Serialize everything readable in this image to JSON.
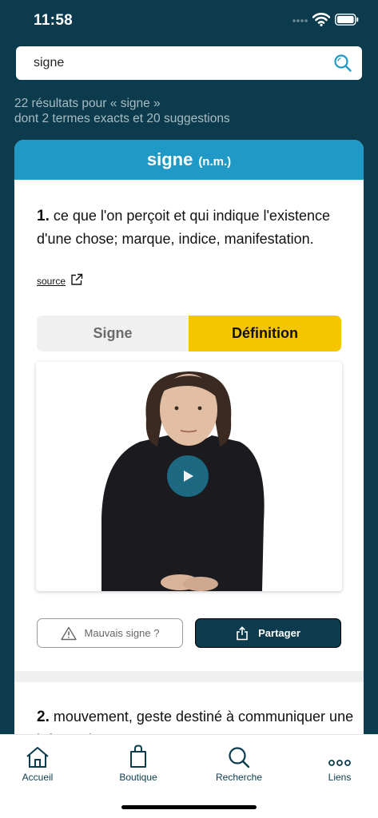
{
  "status_bar": {
    "time": "11:58"
  },
  "search": {
    "query": "signe"
  },
  "results": {
    "summary_line1": "22 résultats pour « signe »",
    "summary_line2": "dont 2 termes exacts et 20 suggestions"
  },
  "entry": {
    "term": "signe",
    "part_of_speech": "(n.m.)",
    "definitions": [
      {
        "number": "1.",
        "text": "ce que l'on perçoit et qui indique l'existence d'une chose; marque, indice, manifestation."
      },
      {
        "number": "2.",
        "text": "mouvement, geste destiné à communiquer une information"
      }
    ],
    "source_label": "source",
    "toggle": {
      "sign_label": "Signe",
      "definition_label": "Définition",
      "active": "Définition"
    },
    "actions": {
      "bad_sign_label": "Mauvais signe ?",
      "share_label": "Partager"
    }
  },
  "tab_bar": {
    "tabs": [
      {
        "label": "Accueil",
        "icon": "home-icon"
      },
      {
        "label": "Boutique",
        "icon": "shopping-bag-icon"
      },
      {
        "label": "Recherche",
        "icon": "search-icon"
      },
      {
        "label": "Liens",
        "icon": "more-dots-icon"
      }
    ]
  },
  "colors": {
    "background": "#0b3b4c",
    "header_blue": "#2199c6",
    "accent_yellow": "#f5c500",
    "play_button": "#1d6e87"
  }
}
